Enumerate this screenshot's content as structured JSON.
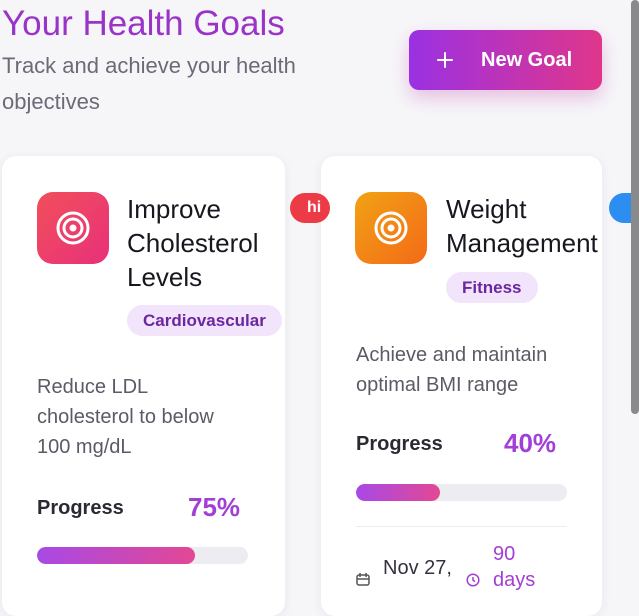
{
  "header": {
    "title": "Your Health Goals",
    "subtitle": "Track and achieve your health objectives",
    "new_goal_label": "New Goal",
    "new_goal_icon": "plus-icon"
  },
  "goals": [
    {
      "title_lines": [
        "Improve",
        "Cholesterol",
        "Levels"
      ],
      "category": "Cardiovascular",
      "description_lines": [
        "Reduce LDL",
        "cholesterol to below",
        "100 mg/dL"
      ],
      "progress_label": "Progress",
      "progress_text": "75%",
      "progress": 0.75,
      "priority_badge": "hi",
      "icon": "target-icon",
      "icon_colors": [
        "#f24f5b",
        "#e8307a"
      ]
    },
    {
      "title_lines": [
        "Weight",
        "Management"
      ],
      "category": "Fitness",
      "description_lines": [
        "Achieve and maintain",
        "optimal BMI range"
      ],
      "progress_label": "Progress",
      "progress_text": "40%",
      "progress": 0.4,
      "target_date": "Nov 27,",
      "days_left": "90",
      "days_unit": "days",
      "icon": "target-icon",
      "icon_colors": [
        "#f2a214",
        "#f36a18"
      ]
    }
  ],
  "colors": {
    "accent_purple": "#a23fd6",
    "title_purple": "#9a33c8",
    "button_gradient": [
      "#9a31e3",
      "#e0368a"
    ],
    "progress_gradient": [
      "#a849e6",
      "#e34894"
    ],
    "priority_high": "#ec3b47",
    "priority_blue": "#2c8ef0",
    "tag_background": "#f1e4fb"
  }
}
